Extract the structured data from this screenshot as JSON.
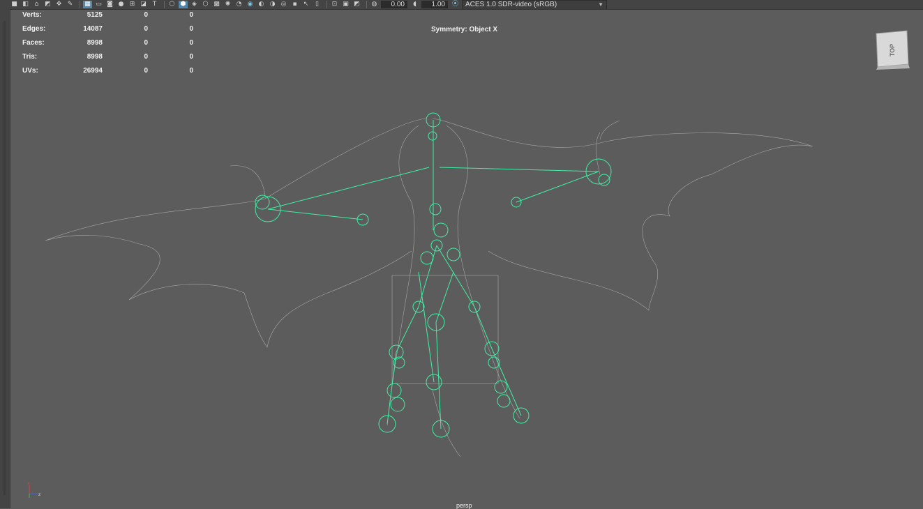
{
  "toolbar": {
    "icons": [
      "camera-icon",
      "camera-attributes-icon",
      "bookmark-icon",
      "image-plane-icon",
      "grid-icon",
      "film-gate-icon",
      "resolution-gate-icon",
      "gate-mask-icon",
      "field-chart-icon",
      "safe-action-icon",
      "safe-title-icon",
      "wireframe-icon",
      "smooth-shade-icon",
      "default-material-icon",
      "textured-icon",
      "use-lights-icon",
      "shadows-icon",
      "ambient-occlusion-icon",
      "motion-blur-icon",
      "anti-alias-icon",
      "depth-of-field-icon",
      "isolate-select-icon",
      "xray-icon",
      "xray-joints-icon",
      "backface-icon",
      "exposure-icon",
      "gamma-icon",
      "color-management-icon"
    ],
    "exposure_value": "0.00",
    "gamma_value": "1.00",
    "colorspace": "ACES 1.0 SDR-video (sRGB)",
    "on_badge": "ON"
  },
  "hud": {
    "rows": [
      {
        "label": "Verts:",
        "v1": "5125",
        "v2": "0",
        "v3": "0"
      },
      {
        "label": "Edges:",
        "v1": "14087",
        "v2": "0",
        "v3": "0"
      },
      {
        "label": "Faces:",
        "v1": "8998",
        "v2": "0",
        "v3": "0"
      },
      {
        "label": "Tris:",
        "v1": "8998",
        "v2": "0",
        "v3": "0"
      },
      {
        "label": "UVs:",
        "v1": "26994",
        "v2": "0",
        "v3": "0"
      }
    ],
    "symmetry": "Symmetry: Object X"
  },
  "viewcube": {
    "face_label": "TOP"
  },
  "camera_label": "persp",
  "colors": {
    "viewport_bg": "#5c5c5c",
    "wireframe": "#a8a8a8",
    "joints": "#3ff0a6",
    "toolbar_bg": "#444444",
    "accent": "#5285a6"
  }
}
